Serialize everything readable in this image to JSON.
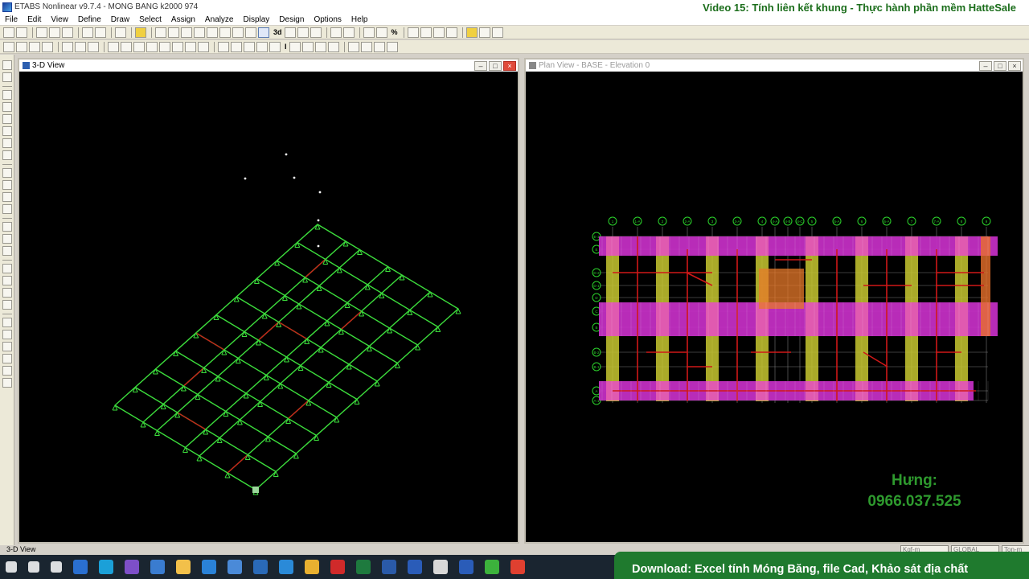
{
  "window": {
    "title": "ETABS Nonlinear v9.7.4 - MONG BANG k2000 974",
    "overlay_title": "Video 15: Tính liên kết khung - Thực hành phần mềm HatteSale"
  },
  "menu": [
    "File",
    "Edit",
    "View",
    "Define",
    "Draw",
    "Select",
    "Assign",
    "Analyze",
    "Display",
    "Design",
    "Options",
    "Help"
  ],
  "toolbar": {
    "label_3d": "3d",
    "label_scale": "%",
    "label_t": "I"
  },
  "views": {
    "left": {
      "title": "3-D View",
      "active": true
    },
    "right": {
      "title": "Plan View - BASE - Elevation 0",
      "active": false
    }
  },
  "window_buttons": {
    "min": "–",
    "max": "□",
    "close": "×"
  },
  "plan": {
    "column_grid_labels": [
      "1",
      "1-A",
      "2",
      "2-A",
      "3",
      "3-A",
      "4",
      "4-A",
      "4-B",
      "4-C",
      "5",
      "5-A",
      "6",
      "6-A",
      "7",
      "7-A",
      "8",
      "9"
    ],
    "row_grid_labels": [
      "E-1",
      "E",
      "D-2",
      "D-1",
      "D",
      "C",
      "B",
      "B-2",
      "B-1",
      "A",
      "A-1"
    ]
  },
  "status": {
    "text": "3-D View",
    "fields": [
      "Kgf-m",
      "GLOBAL",
      "Ton-m"
    ]
  },
  "taskbar_icons": [
    "windows-start",
    "search",
    "task-view",
    "photoshop",
    "edge",
    "visual-studio",
    "remote-desktop",
    "file-explorer",
    "mail",
    "store",
    "bitlocker",
    "camtasia",
    "chrome",
    "autocad",
    "excel",
    "etabs",
    "word",
    "sap2000",
    "word",
    "camtasia-green",
    "camtasia-red"
  ],
  "promo": {
    "contact_name": "Hưng:",
    "phone": "0966.037.525",
    "banner": "Download: Excel tính Móng Băng, file Cad, Khảo sát địa chất"
  },
  "colors": {
    "strip": "#c830c8",
    "column_strip": "#c8c830",
    "beam": "#d01818",
    "model_lines": "#3cdc3c",
    "accent_overlay": "#1f7a2e"
  }
}
